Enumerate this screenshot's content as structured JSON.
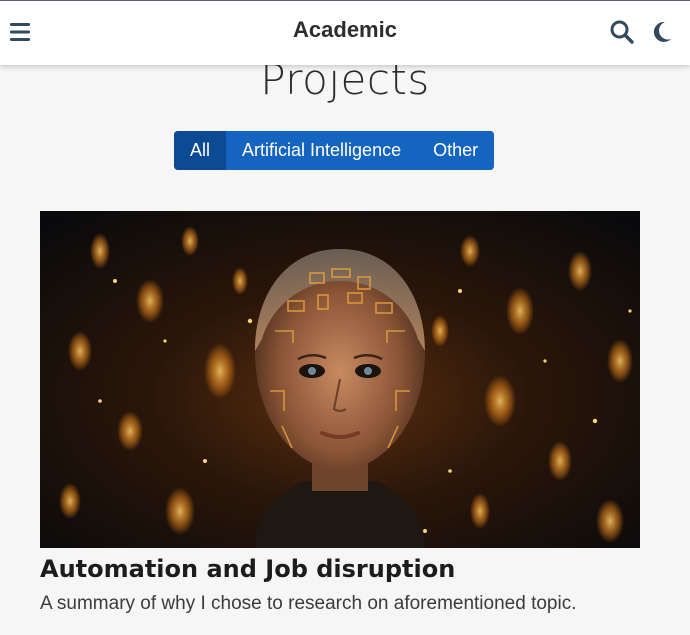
{
  "navbar": {
    "brand": "Academic",
    "icons": {
      "menu": "menu-icon",
      "search": "search-icon",
      "theme": "moon-icon"
    }
  },
  "page": {
    "title": "Projects"
  },
  "filters": {
    "items": [
      {
        "label": "All",
        "active": true
      },
      {
        "label": "Artificial Intelligence",
        "active": false
      },
      {
        "label": "Other",
        "active": false
      }
    ]
  },
  "projects": [
    {
      "title": "Automation and Job disruption",
      "summary": "A summary of why I chose to research on aforementioned topic."
    }
  ],
  "colors": {
    "accent": "#1565c0",
    "accent_active": "#0d4a94",
    "background": "#f6f6f7",
    "icon": "#34495e"
  }
}
